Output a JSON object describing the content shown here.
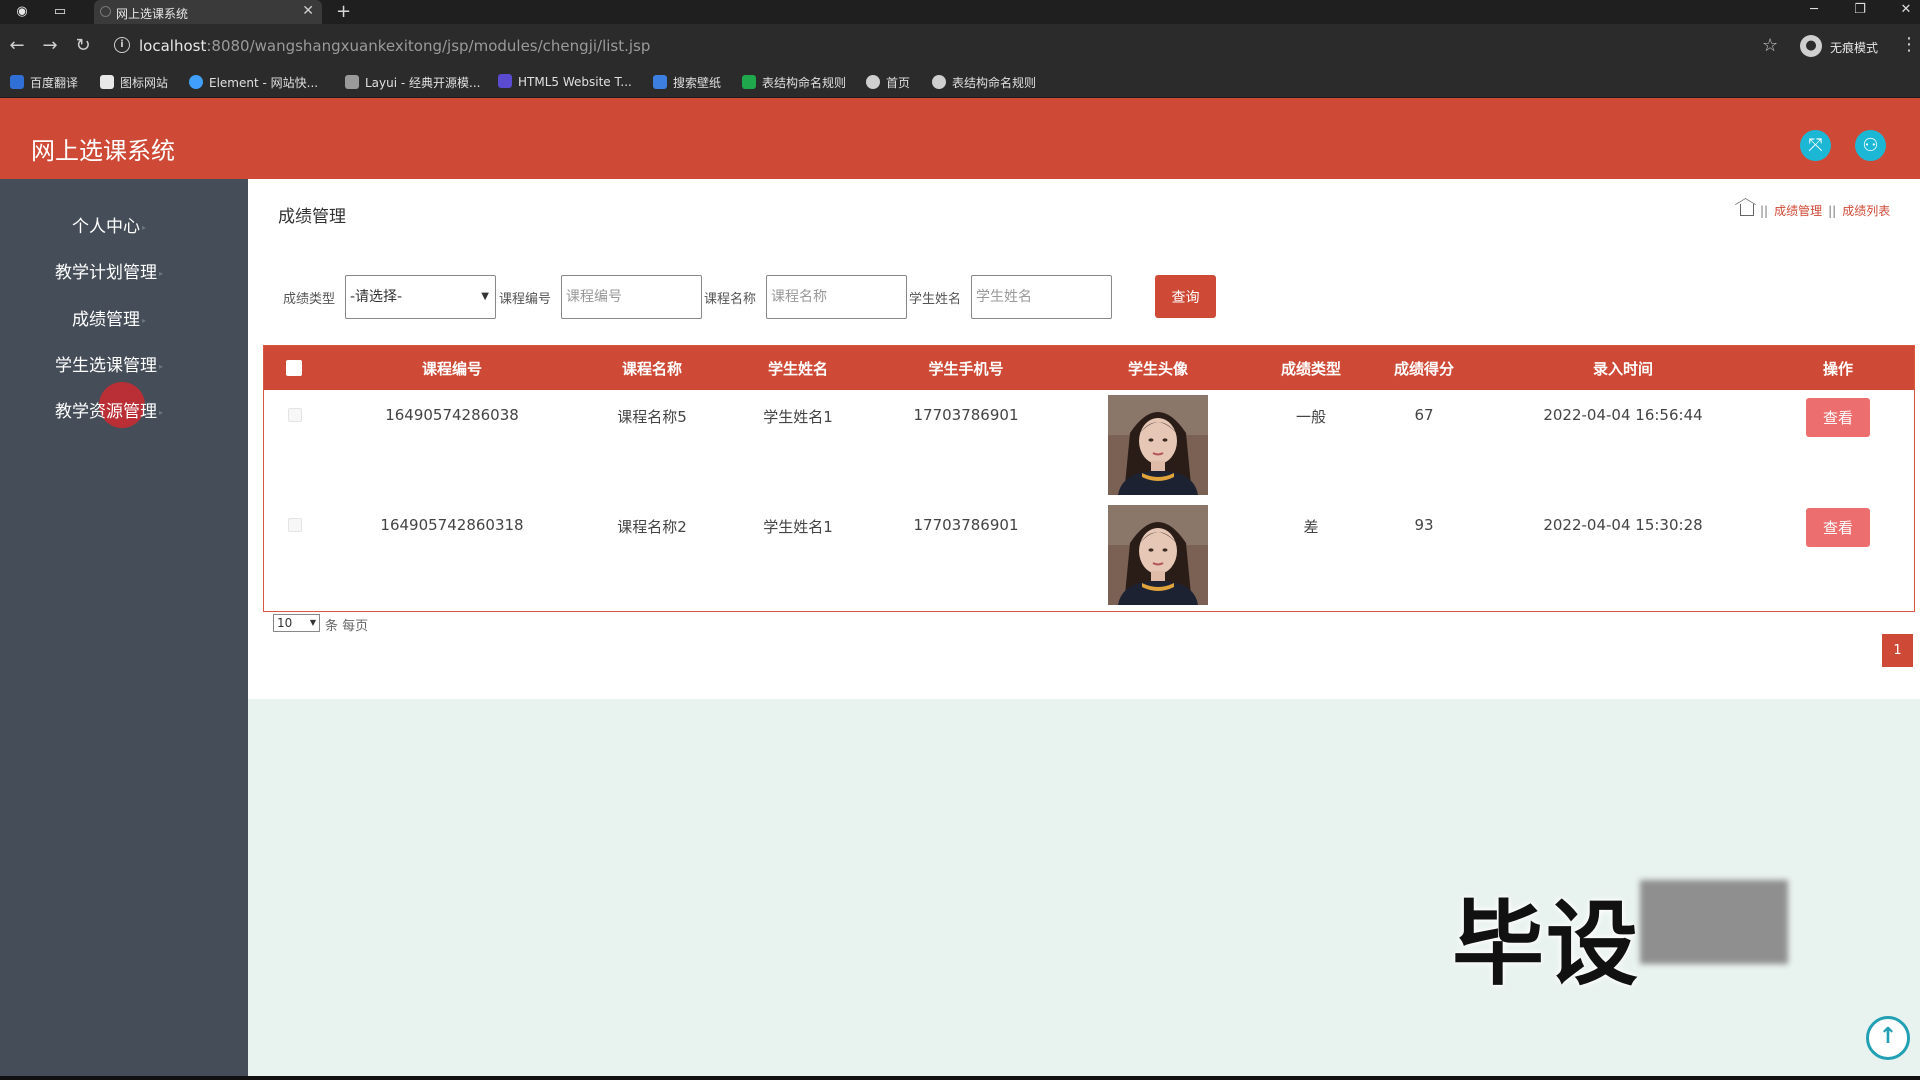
{
  "browser": {
    "tab_title": "网上选课系统",
    "url_host": "localhost",
    "url_rest": ":8080/wangshangxuankexitong/jsp/modules/chengji/list.jsp",
    "profile_label": "无痕模式",
    "bookmarks": [
      {
        "label": "百度翻译",
        "color": "#2f6fd6"
      },
      {
        "label": "图标网站",
        "color": "#e8e8e8"
      },
      {
        "label": "Element - 网站快...",
        "color": "#409eff"
      },
      {
        "label": "Layui - 经典开源模...",
        "color": "#9a9a9a"
      },
      {
        "label": "HTML5 Website T...",
        "color": "#5a4bd1"
      },
      {
        "label": "搜索壁纸",
        "color": "#3d7fe0"
      },
      {
        "label": "表结构命名规则",
        "color": "#20a84d"
      },
      {
        "label": "首页",
        "color": "#cfcfcf"
      },
      {
        "label": "表结构命名规则",
        "color": "#cfcfcf"
      }
    ]
  },
  "app": {
    "title": "网上选课系统",
    "header_color": "#cf4a36"
  },
  "sidebar": {
    "items": [
      {
        "label": "个人中心"
      },
      {
        "label": "教学计划管理"
      },
      {
        "label": "成绩管理"
      },
      {
        "label": "学生选课管理"
      },
      {
        "label": "教学资源管理"
      }
    ]
  },
  "page": {
    "title": "成绩管理",
    "breadcrumb": [
      "成绩管理",
      "成绩列表"
    ]
  },
  "filters": {
    "type_label": "成绩类型",
    "type_value": "-请选择-",
    "course_no_label": "课程编号",
    "course_no_placeholder": "课程编号",
    "course_name_label": "课程名称",
    "course_name_placeholder": "课程名称",
    "student_name_label": "学生姓名",
    "student_name_placeholder": "学生姓名",
    "query_button": "查询"
  },
  "table": {
    "columns": [
      "课程编号",
      "课程名称",
      "学生姓名",
      "学生手机号",
      "学生头像",
      "成绩类型",
      "成绩得分",
      "录入时间",
      "操作"
    ],
    "rows": [
      {
        "course_no": "16490574286038",
        "course_name": "课程名称5",
        "student_name": "学生姓名1",
        "phone": "17703786901",
        "grade_type": "一般",
        "score": "67",
        "entry_time": "2022-04-04 16:56:44",
        "action": "查看"
      },
      {
        "course_no": "164905742860318",
        "course_name": "课程名称2",
        "student_name": "学生姓名1",
        "phone": "17703786901",
        "grade_type": "差",
        "score": "93",
        "entry_time": "2022-04-04 15:30:28",
        "action": "查看"
      }
    ]
  },
  "pagination": {
    "page_size": "10",
    "page_size_label": "条 每页",
    "current_page": "1"
  },
  "overlay": {
    "watermark": "毕设"
  }
}
